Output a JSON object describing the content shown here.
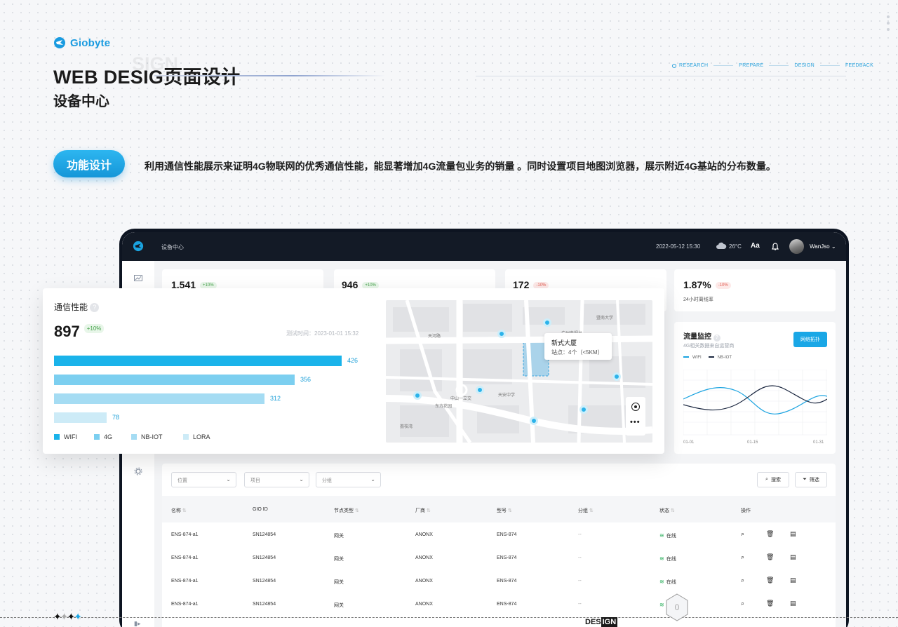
{
  "brand": {
    "name": "Giobyte"
  },
  "header": {
    "title": "WEB DESIG页面设计",
    "ghost": "SIGN",
    "subtitle": "设备中心"
  },
  "steps": [
    "RESEARCH",
    "PREPARE",
    "DESIGN",
    "FEEDBACK"
  ],
  "feature": {
    "pill": "功能设计",
    "desc": "利用通信性能展示来证明4G物联网的优秀通信性能，能显著增加4G流量包业务的销量 。同时设置项目地图浏览器，展示附近4G基站的分布数量。"
  },
  "app": {
    "title": "设备中心",
    "datetime": "2022-05-12  15:30",
    "temp": "26°C",
    "font_btn": "Aa",
    "user": "WanJso"
  },
  "stats": [
    {
      "value": "1,541",
      "badge": "+10%"
    },
    {
      "value": "946",
      "badge": "+10%"
    },
    {
      "value": "172",
      "badge": "-10%"
    },
    {
      "value": "1.87%",
      "badge": "-10%",
      "label": "24小时离线率"
    }
  ],
  "traffic": {
    "title": "流量监控",
    "sub": "4G相关数据来自运营商",
    "button": "网络拓扑",
    "legend": [
      "WIFI",
      "NB-IOT"
    ],
    "x": [
      "01-01",
      "01-15",
      "01-31"
    ],
    "colors": {
      "wifi": "#1aa3e0",
      "nbiot": "#1b2740"
    }
  },
  "comm": {
    "title": "通信性能",
    "value": "897",
    "badge": "+10%",
    "time": "测试时间：2023-01-01 15:32"
  },
  "chart_data": {
    "type": "bar",
    "orientation": "horizontal",
    "categories": [
      "WIFI",
      "4G",
      "NB-IOT",
      "LORA"
    ],
    "values": [
      426,
      356,
      312,
      78
    ],
    "colors": [
      "#1ab3ea",
      "#7ccff0",
      "#a5dcf3",
      "#cdebf7"
    ]
  },
  "map": {
    "popup_title": "新式大厦",
    "popup_sub": "站点：4个（<5KM）",
    "labels": [
      "天河路",
      "中山一立交",
      "东方花园",
      "广州电视台",
      "天安中学",
      "暨南大学",
      "荔枝湾"
    ]
  },
  "filters": {
    "f1": "位置",
    "f2": "项目",
    "f3": "分组",
    "search": "搜索",
    "filter": "筛选"
  },
  "table": {
    "headers": [
      "名称",
      "GIO ID",
      "节点类型",
      "厂商",
      "型号",
      "分组",
      "状态",
      "操作"
    ],
    "rows": [
      [
        "ENS-874-a1",
        "SN124854",
        "网关",
        "ANONX",
        "ENS-874",
        "--",
        "在线"
      ],
      [
        "ENS-874-a1",
        "SN124854",
        "网关",
        "ANONX",
        "ENS-874",
        "--",
        "在线"
      ],
      [
        "ENS-874-a1",
        "SN124854",
        "网关",
        "ANONX",
        "ENS-874",
        "--",
        "在线"
      ],
      [
        "ENS-874-a1",
        "SN124854",
        "网关",
        "ANONX",
        "ENS-874",
        "--",
        "在线"
      ]
    ]
  },
  "footer": {
    "design_a": "DES",
    "design_b": "IGN",
    "hex": "0"
  }
}
